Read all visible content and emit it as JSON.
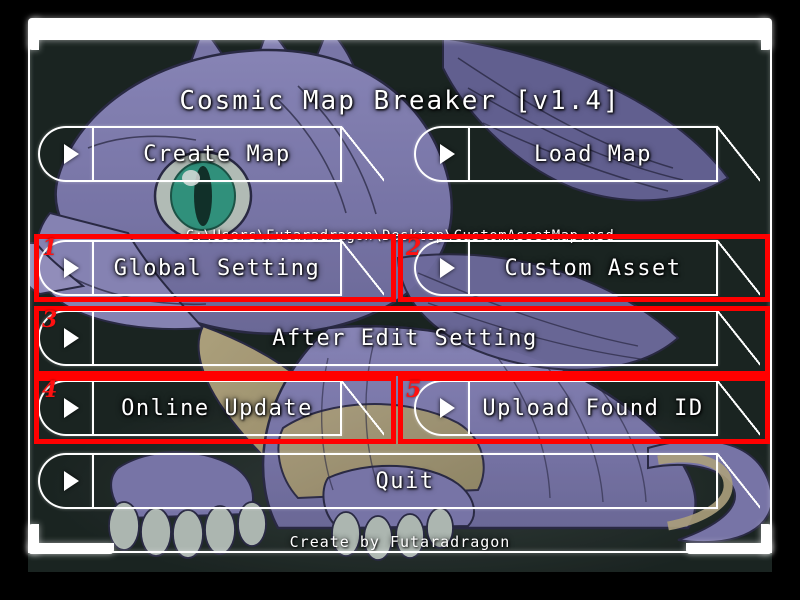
{
  "window": {
    "title": "Cosmic Map Breaker [v1.4]",
    "background_color": "#1b2422",
    "frame_color": "#ffffff",
    "outer_color": "#000000"
  },
  "header": {
    "title": "Cosmic Map Breaker [v1.4]"
  },
  "file_path": {
    "value": "C:\\Users\\Futaradragon\\Desktop\\CustomAssetMap.nsd"
  },
  "menu": {
    "arrow_icon": "play-triangle-icon",
    "buttons": [
      {
        "id": "create-map",
        "label": "Create Map"
      },
      {
        "id": "load-map",
        "label": "Load Map"
      },
      {
        "id": "global-setting",
        "label": "Global Setting"
      },
      {
        "id": "custom-asset",
        "label": "Custom Asset"
      },
      {
        "id": "after-edit-setting",
        "label": "After Edit Setting"
      },
      {
        "id": "online-update",
        "label": "Online Update"
      },
      {
        "id": "upload-found-id",
        "label": "Upload Found ID"
      },
      {
        "id": "quit",
        "label": "Quit"
      }
    ]
  },
  "annotations": {
    "color": "#ff0000",
    "boxes": [
      {
        "number": "1",
        "target": "Global Setting"
      },
      {
        "number": "2",
        "target": "Custom Asset"
      },
      {
        "number": "3",
        "target": "After Edit Setting"
      },
      {
        "number": "4",
        "target": "Online Update"
      },
      {
        "number": "5",
        "target": "Upload Found ID"
      }
    ]
  },
  "footer": {
    "credit": "Create by Futaradragon"
  },
  "artwork": {
    "subject": "purple-dragon-illustration",
    "body_color": "#8f8ac4",
    "belly_color": "#b9a882",
    "wing_color": "#6f6aa5",
    "eye_color": "#35a58d",
    "claw_color": "#c9d2cc",
    "shadow_color": "#2a3331"
  }
}
